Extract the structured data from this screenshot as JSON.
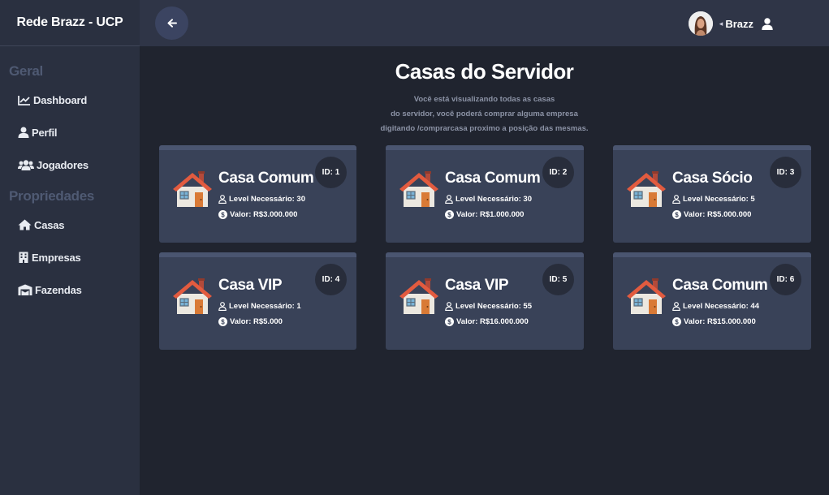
{
  "brand": "Rede Brazz - UCP",
  "sidebar": {
    "sections": [
      {
        "title": "Geral",
        "items": [
          {
            "label": "Dashboard",
            "icon": "chart-line-icon"
          },
          {
            "label": "Perfil",
            "icon": "user-icon"
          },
          {
            "label": "Jogadores",
            "icon": "users-icon"
          }
        ]
      },
      {
        "title": "Propriedades",
        "items": [
          {
            "label": "Casas",
            "icon": "house-icon"
          },
          {
            "label": "Empresas",
            "icon": "building-icon"
          },
          {
            "label": "Fazendas",
            "icon": "warehouse-icon"
          }
        ]
      }
    ]
  },
  "topbar": {
    "username": "Brazz"
  },
  "main": {
    "title": "Casas do Servidor",
    "subtitle": [
      "Você está visualizando todas as casas",
      "do servidor, você poderá comprar alguma empresa",
      "digitando /comprarcasa proximo a posição das mesmas."
    ]
  },
  "cards": [
    {
      "id": "ID: 1",
      "name": "Casa Comum",
      "level": "Level Necessário: 30",
      "value": "Valor: R$3.000.000"
    },
    {
      "id": "ID: 2",
      "name": "Casa Comum",
      "level": "Level Necessário: 30",
      "value": "Valor: R$1.000.000"
    },
    {
      "id": "ID: 3",
      "name": "Casa Sócio",
      "level": "Level Necessário: 5",
      "value": "Valor: R$5.000.000"
    },
    {
      "id": "ID: 4",
      "name": "Casa VIP",
      "level": "Level Necessário: 1",
      "value": "Valor: R$5.000"
    },
    {
      "id": "ID: 5",
      "name": "Casa VIP",
      "level": "Level Necessário: 55",
      "value": "Valor: R$16.000.000"
    },
    {
      "id": "ID: 6",
      "name": "Casa Comum",
      "level": "Level Necessário: 44",
      "value": "Valor: R$15.000.000"
    }
  ]
}
